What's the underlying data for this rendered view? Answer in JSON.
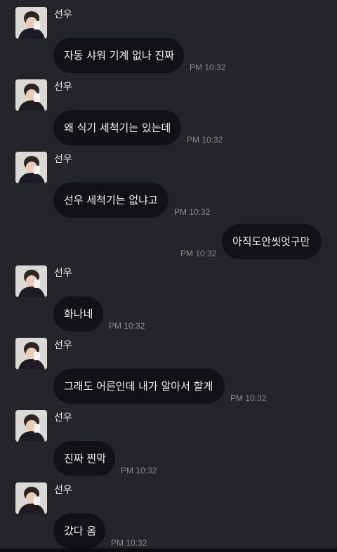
{
  "colors": {
    "background": "#24252b",
    "bubble": "#121216",
    "text": "#f2f2f2",
    "timestamp": "#8a8b90"
  },
  "messages": [
    {
      "sender": "선우",
      "text": "자동 샤워 기계 없나 진짜",
      "time": "PM 10:32",
      "outgoing": false
    },
    {
      "sender": "선우",
      "text": "왜 식기 세척기는 있는데",
      "time": "PM 10:32",
      "outgoing": false
    },
    {
      "sender": "선우",
      "text": "선우 세척기는 없냐고",
      "time": "PM 10:32",
      "outgoing": false
    },
    {
      "text": "아직도안씻엇구만",
      "time": "PM 10:32",
      "outgoing": true
    },
    {
      "sender": "선우",
      "text": "화나네",
      "time": "PM 10:32",
      "outgoing": false
    },
    {
      "sender": "선우",
      "text": "그래도 어른인데 내가 알아서 할게",
      "time": "PM 10:32",
      "outgoing": false
    },
    {
      "sender": "선우",
      "text": "진짜 찐막",
      "time": "PM 10:32",
      "outgoing": false
    },
    {
      "sender": "선우",
      "text": "갔다 옴",
      "time": "PM 10:32",
      "outgoing": false
    }
  ]
}
